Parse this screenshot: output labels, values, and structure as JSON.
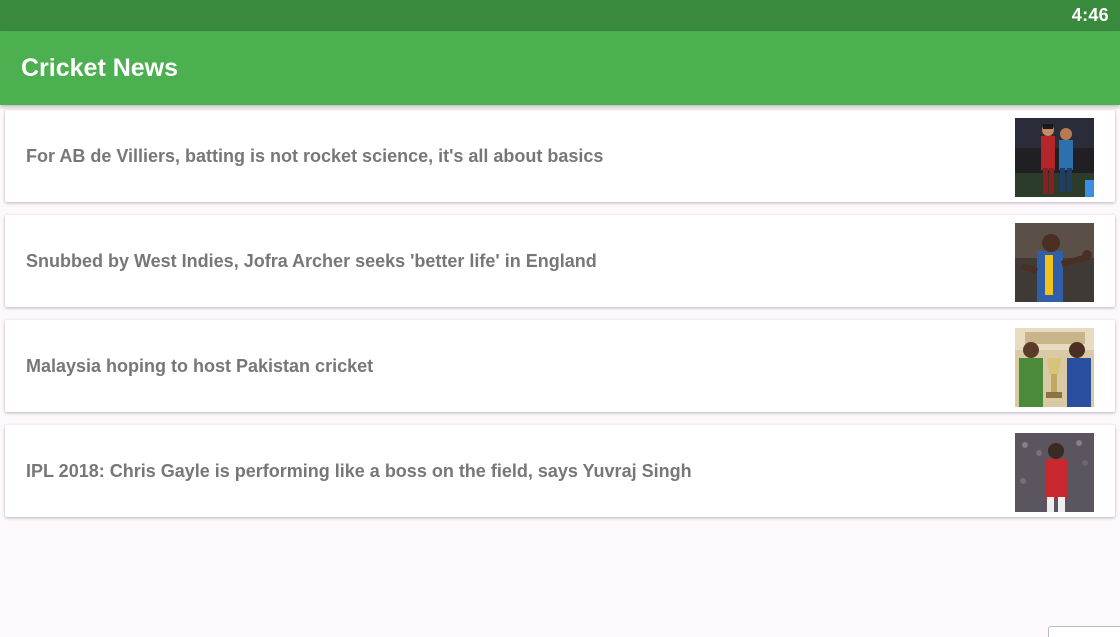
{
  "status_bar": {
    "time": "4:46"
  },
  "app_bar": {
    "title": "Cricket News"
  },
  "news": [
    {
      "title": "For AB de Villiers, batting is not rocket science, it's all about basics",
      "thumbnail": "cricket-players-photo"
    },
    {
      "title": "Snubbed by West Indies, Jofra Archer seeks 'better life' in England",
      "thumbnail": "bowler-celebrating-photo"
    },
    {
      "title": "Malaysia hoping to host Pakistan cricket",
      "thumbnail": "trophy-presentation-photo"
    },
    {
      "title": "IPL 2018: Chris Gayle is performing like a boss on the field, says Yuvraj Singh",
      "thumbnail": "batsman-stadium-photo"
    }
  ],
  "colors": {
    "status_bar": "#3a8a3e",
    "app_bar": "#4caf50",
    "background": "#fdf8fc",
    "title_text": "#777777"
  }
}
